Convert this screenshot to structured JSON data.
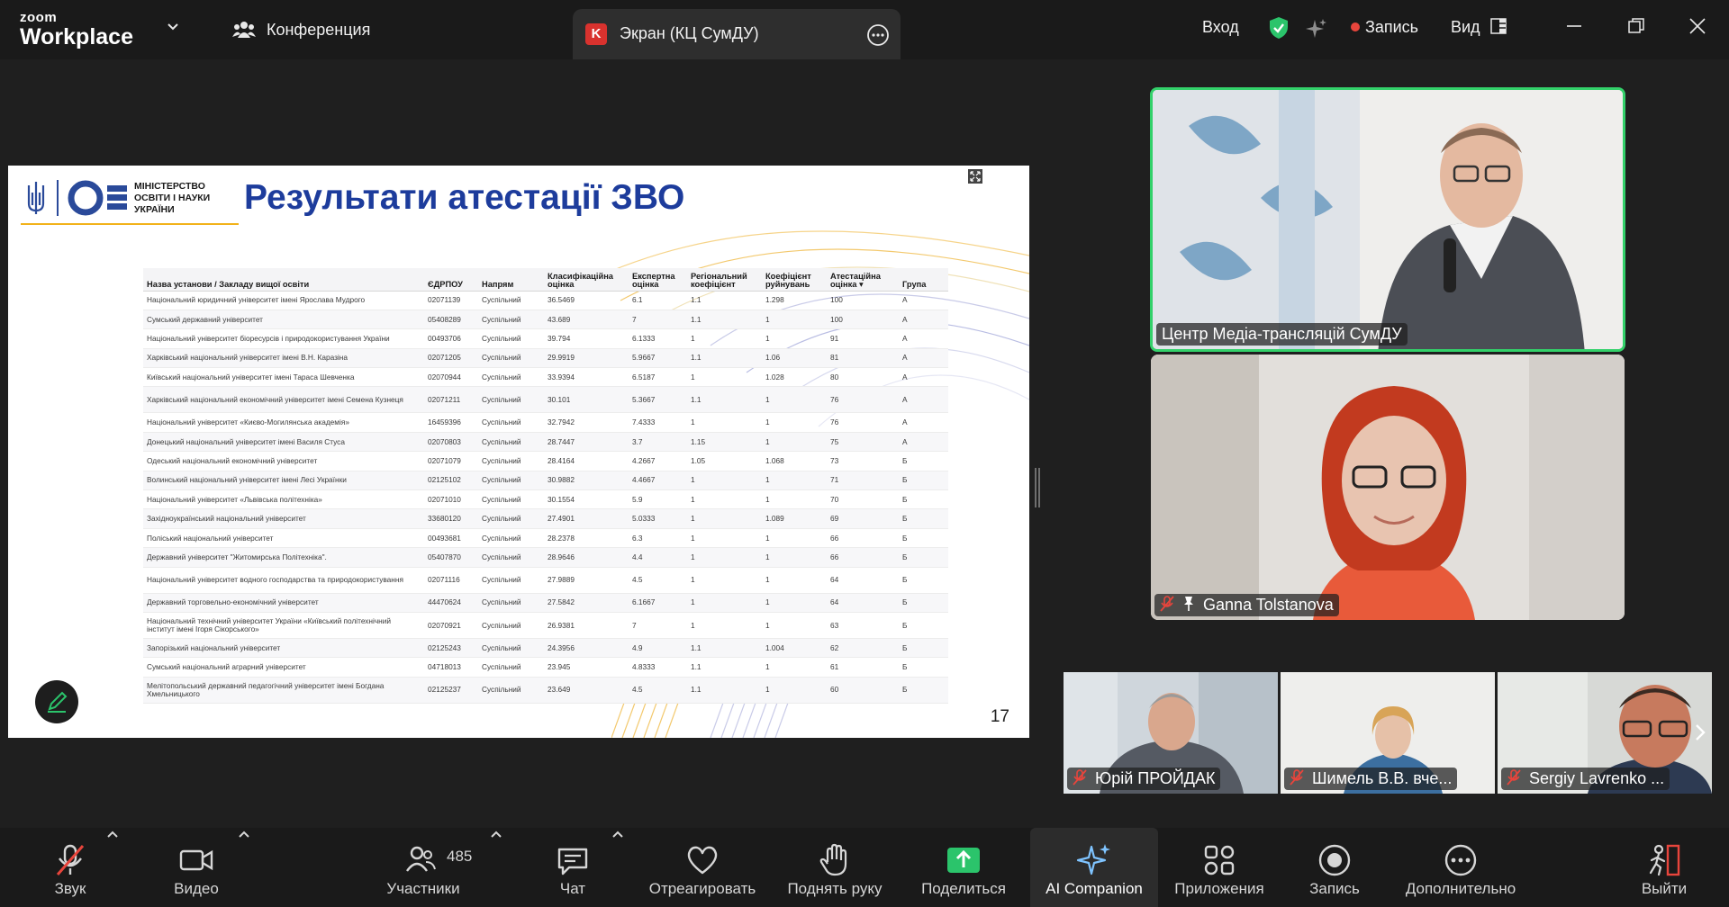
{
  "app": {
    "brand_top": "zoom",
    "brand_bottom": "Workplace"
  },
  "header": {
    "meeting_label": "Конференция",
    "share_tab": {
      "badge": "K",
      "title": "Экран (КЦ СумДУ)"
    },
    "signin_label": "Вход",
    "record_label": "Запись",
    "view_label": "Вид"
  },
  "slide": {
    "org_lines": [
      "МІНІСТЕРСТВО",
      "ОСВІТИ І НАУКИ",
      "УКРАЇНИ"
    ],
    "title": "Результати атестації ЗВО",
    "page_number": "17",
    "columns": [
      "Назва установи / Закладу вищої освіти",
      "ЄДРПОУ",
      "Напрям",
      "Класифікаційна оцінка",
      "Експертна оцінка",
      "Регіональний коефіцієнт",
      "Коефіцієнт руйнувань",
      "Атестаційна оцінка ▾",
      "Група"
    ],
    "rows": [
      [
        "Національний юридичний університет імені Ярослава Мудрого",
        "02071139",
        "Суспільний",
        "36.5469",
        "6.1",
        "1.1",
        "1.298",
        "100",
        "А"
      ],
      [
        "Сумський державний університет",
        "05408289",
        "Суспільний",
        "43.689",
        "7",
        "1.1",
        "1",
        "100",
        "А"
      ],
      [
        "Національний університет біоресурсів і природокористування України",
        "00493706",
        "Суспільний",
        "39.794",
        "6.1333",
        "1",
        "1",
        "91",
        "А"
      ],
      [
        "Харківський національний університет імені В.Н. Каразіна",
        "02071205",
        "Суспільний",
        "29.9919",
        "5.9667",
        "1.1",
        "1.06",
        "81",
        "А"
      ],
      [
        "Київський національний університет імені Тараса Шевченка",
        "02070944",
        "Суспільний",
        "33.9394",
        "6.5187",
        "1",
        "1.028",
        "80",
        "А"
      ],
      [
        "Харківський національний економічний університет імені Семена Кузнеця",
        "02071211",
        "Суспільний",
        "30.101",
        "5.3667",
        "1.1",
        "1",
        "76",
        "А"
      ],
      [
        "Національний університет «Києво-Могилянська академія»",
        "16459396",
        "Суспільний",
        "32.7942",
        "7.4333",
        "1",
        "1",
        "76",
        "А"
      ],
      [
        "Донецький національний університет імені Василя Стуса",
        "02070803",
        "Суспільний",
        "28.7447",
        "3.7",
        "1.15",
        "1",
        "75",
        "А"
      ],
      [
        "Одеський національний економічний університет",
        "02071079",
        "Суспільний",
        "28.4164",
        "4.2667",
        "1.05",
        "1.068",
        "73",
        "Б"
      ],
      [
        "Волинський національний університет імені Лесі Українки",
        "02125102",
        "Суспільний",
        "30.9882",
        "4.4667",
        "1",
        "1",
        "71",
        "Б"
      ],
      [
        "Національний університет «Львівська політехніка»",
        "02071010",
        "Суспільний",
        "30.1554",
        "5.9",
        "1",
        "1",
        "70",
        "Б"
      ],
      [
        "Західноукраїнський національний університет",
        "33680120",
        "Суспільний",
        "27.4901",
        "5.0333",
        "1",
        "1.089",
        "69",
        "Б"
      ],
      [
        "Поліський національний університет",
        "00493681",
        "Суспільний",
        "28.2378",
        "6.3",
        "1",
        "1",
        "66",
        "Б"
      ],
      [
        "Державний університет \"Житомирська Політехніка\".",
        "05407870",
        "Суспільний",
        "28.9646",
        "4.4",
        "1",
        "1",
        "66",
        "Б"
      ],
      [
        "Національний університет водного господарства та природокористування",
        "02071116",
        "Суспільний",
        "27.9889",
        "4.5",
        "1",
        "1",
        "64",
        "Б"
      ],
      [
        "Державний торговельно-економічний університет",
        "44470624",
        "Суспільний",
        "27.5842",
        "6.1667",
        "1",
        "1",
        "64",
        "Б"
      ],
      [
        "Національний технічний університет України «Київський політехнічний інститут імені Ігоря Сікорського»",
        "02070921",
        "Суспільний",
        "26.9381",
        "7",
        "1",
        "1",
        "63",
        "Б"
      ],
      [
        "Запорізький національний університет",
        "02125243",
        "Суспільний",
        "24.3956",
        "4.9",
        "1.1",
        "1.004",
        "62",
        "Б"
      ],
      [
        "Сумський національний аграрний університет",
        "04718013",
        "Суспільний",
        "23.945",
        "4.8333",
        "1.1",
        "1",
        "61",
        "Б"
      ],
      [
        "Мелітопольський державний педагогічний університет імені Богдана Хмельницького",
        "02125237",
        "Суспільний",
        "23.649",
        "4.5",
        "1.1",
        "1",
        "60",
        "Б"
      ]
    ]
  },
  "participants": {
    "main": [
      {
        "name": "Центр Медіа-трансляцій СумДУ",
        "speaking": true
      },
      {
        "name": "Ganna Tolstanova",
        "muted": true,
        "pinned": true
      }
    ],
    "strip": [
      {
        "name": "Юрій ПРОЙДАК",
        "muted": true
      },
      {
        "name": "Шимель В.В. вче...",
        "muted": true
      },
      {
        "name": "Sergiy Lavrenko ...",
        "muted": true
      }
    ]
  },
  "toolbar": {
    "audio": "Звук",
    "video": "Видео",
    "participants": "Участники",
    "participants_count": "485",
    "chat": "Чат",
    "react": "Отреагировать",
    "raise_hand": "Поднять руку",
    "share": "Поделиться",
    "ai": "AI Companion",
    "apps": "Приложения",
    "record": "Запись",
    "more": "Дополнительно",
    "leave": "Выйти"
  },
  "colors": {
    "speaking_border": "#33d16a",
    "share_green": "#2bc46b",
    "leave_red": "#e8453c",
    "slide_title_blue": "#1d3c9c"
  }
}
